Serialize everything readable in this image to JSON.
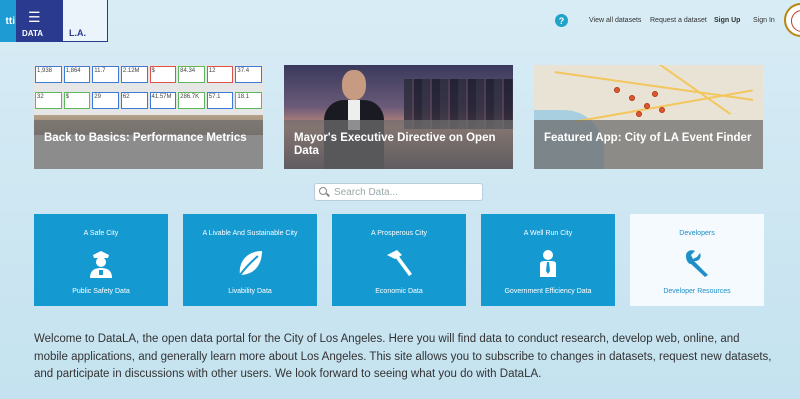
{
  "header": {
    "edge_tile_text": "tti",
    "data_tile_label": "DATA",
    "la_tile_label": "L.A.",
    "help_glyph": "?",
    "nav": [
      {
        "label": "View all datasets",
        "bold": false
      },
      {
        "label": "Request a dataset",
        "bold": false
      },
      {
        "label": "Sign Up",
        "bold": true
      },
      {
        "label": "Sign In",
        "bold": false
      }
    ]
  },
  "features": [
    {
      "title": "Back to Basics: Performance Metrics"
    },
    {
      "title": "Mayor's Executive Directive on Open Data"
    },
    {
      "title": "Featured App: City of LA Event Finder"
    }
  ],
  "search": {
    "placeholder": "Search Data..."
  },
  "categories": [
    {
      "title": "A Safe City",
      "subtitle": "Public Safety Data",
      "icon": "police-officer-icon"
    },
    {
      "title": "A Livable And Sustainable City",
      "subtitle": "Livability Data",
      "icon": "leaf-icon"
    },
    {
      "title": "A Prosperous City",
      "subtitle": "Economic Data",
      "icon": "hammer-icon"
    },
    {
      "title": "A Well Run City",
      "subtitle": "Government Efficiency Data",
      "icon": "businessperson-icon"
    },
    {
      "title": "Developers",
      "subtitle": "Developer Resources",
      "icon": "wrench-icon"
    }
  ],
  "welcome_text": "Welcome to DataLA, the open data portal for the City of Los Angeles. Here you will find data to conduct research, develop web, online, and mobile applications, and generally learn more about Los Angeles. This site allows you to subscribe to changes in datasets, request new datasets, and participate in discussions with other users. We look forward to seeing what you do with DataLA.",
  "colors": {
    "tile_blue": "#1599d1",
    "nav_navy": "#2a3a8e",
    "developer_tile_bg": "#f4fafd"
  }
}
